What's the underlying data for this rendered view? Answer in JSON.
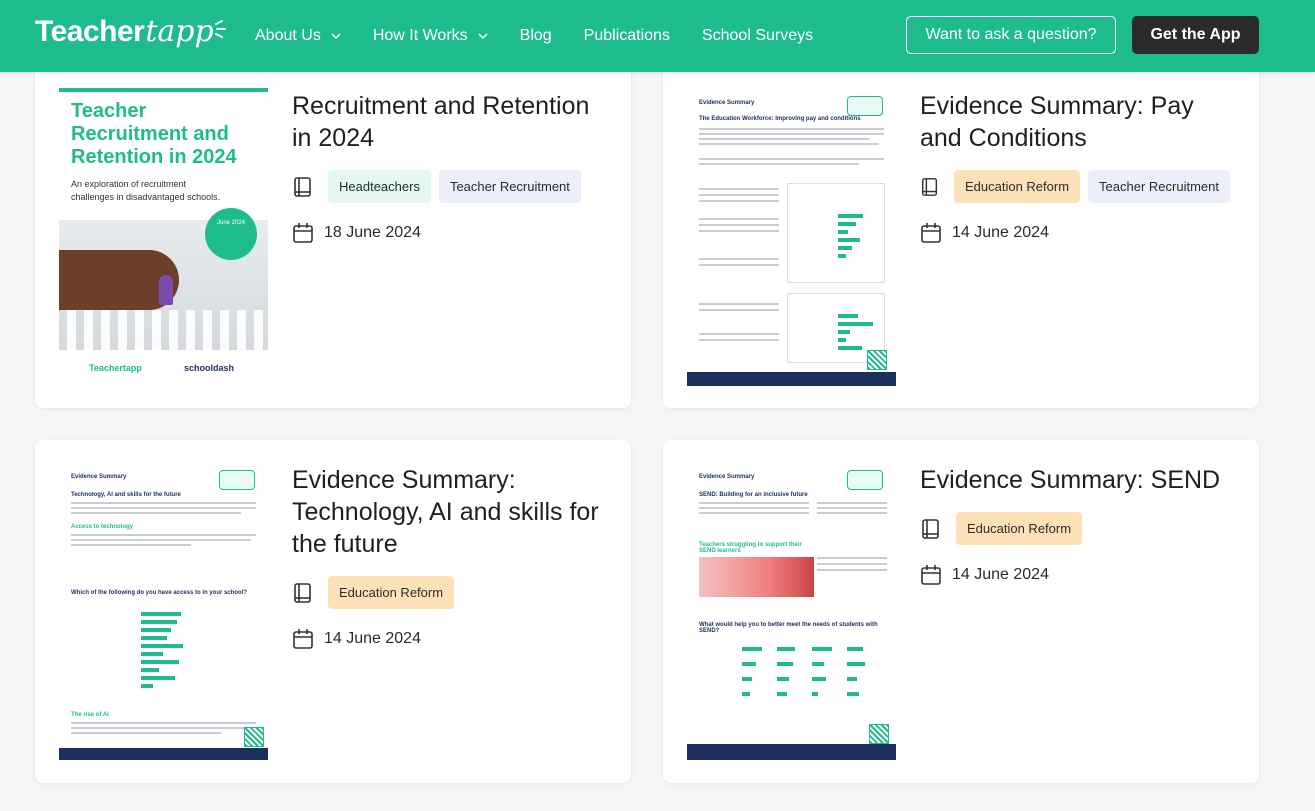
{
  "nav": {
    "logo_text_a": "Teacher",
    "logo_text_b": "tapp",
    "items": [
      {
        "label": "About Us",
        "dropdown": true
      },
      {
        "label": "How It Works",
        "dropdown": true
      },
      {
        "label": "Blog",
        "dropdown": false
      },
      {
        "label": "Publications",
        "dropdown": false
      },
      {
        "label": "School Surveys",
        "dropdown": false
      }
    ],
    "ask_button": "Want to ask a question?",
    "app_button": "Get the App"
  },
  "cards": [
    {
      "title": "Recruitment and Retention in 2024",
      "tags": [
        "Headteachers",
        "Teacher Recruitment"
      ],
      "date": "18 June 2024",
      "thumb": {
        "title": "Teacher Recruitment and Retention in 2024",
        "subtitle": "An exploration of recruitment challenges in disadvantaged schools.",
        "badge": "June 2024",
        "logo_a": "Teachertapp",
        "logo_b": "schooldash"
      }
    },
    {
      "title": "Evidence Summary: Pay and Conditions",
      "tags": [
        "Education Reform",
        "Teacher Recruitment"
      ],
      "date": "14 June 2024",
      "thumb": {
        "label": "Evidence Summary",
        "heading": "The Education Workforce: Improving pay and conditions"
      }
    },
    {
      "title": "Evidence Summary: Technology, AI and skills for the future",
      "tags": [
        "Education Reform"
      ],
      "date": "14 June 2024",
      "thumb": {
        "label": "Evidence Summary",
        "heading": "Technology, AI and skills for the future",
        "section": "Access to technology",
        "chart_title": "Which of the following do you have access to in your school?",
        "section2": "The rise of AI"
      }
    },
    {
      "title": "Evidence Summary: SEND",
      "tags": [
        "Education Reform"
      ],
      "date": "14 June 2024",
      "thumb": {
        "label": "Evidence Summary",
        "heading": "SEND: Building for an inclusive future",
        "section": "Teachers struggling to support their SEND learners",
        "chart_title": "What would help you to better meet the needs of students with SEND?"
      }
    }
  ],
  "colors": {
    "brand": "#1ebc8c",
    "dark_button": "#2b2b2b",
    "tag_green": "#e4f7f0",
    "tag_lilac": "#eceef9",
    "tag_orange": "#fde1b9",
    "navy": "#1d2f5b"
  },
  "icons": {
    "tag": "book-icon",
    "date": "calendar-icon",
    "dropdown": "chevron-down-icon"
  }
}
